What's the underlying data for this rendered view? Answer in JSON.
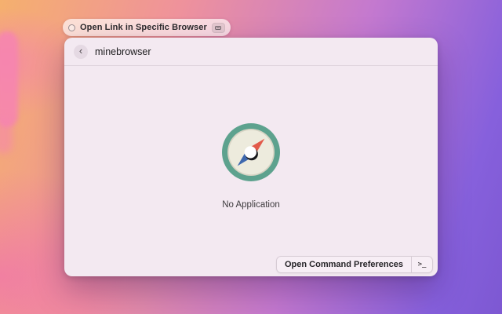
{
  "command_pill": {
    "label": "Open Link in Specific Browser"
  },
  "window": {
    "header": {
      "back_glyph": "‹",
      "search_value": "minebrowser"
    },
    "empty_state": {
      "message": "No Application"
    },
    "footer": {
      "action_label": "Open Command Preferences",
      "shortcut": ">_"
    }
  },
  "colors": {
    "compass_ring": "#5da28e",
    "compass_face": "#edebdd",
    "needle_north": "#e25a4a",
    "needle_south": "#3e68ae",
    "window_background": "#f3e9f1",
    "wallpaper_orange": "#f5b06e",
    "wallpaper_pink": "#ef929b",
    "wallpaper_purple": "#7d58d2"
  }
}
